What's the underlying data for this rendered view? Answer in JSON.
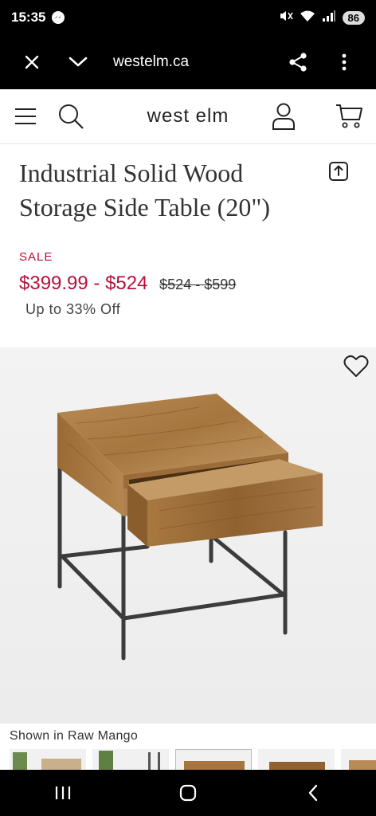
{
  "status_bar": {
    "time": "15:35",
    "battery": "86"
  },
  "browser": {
    "url": "westelm.ca"
  },
  "site": {
    "logo": "west elm"
  },
  "product": {
    "title": "Industrial Solid Wood Storage Side Table (20\")",
    "sale_label": "SALE",
    "price": "$399.99 - $524",
    "old_price": "$524 - $599",
    "discount": "Up to 33% Off",
    "shown_in": "Shown in Raw Mango"
  },
  "colors": {
    "sale": "#b3123a",
    "wood": "#a0733f",
    "metal": "#3c3c3c"
  }
}
